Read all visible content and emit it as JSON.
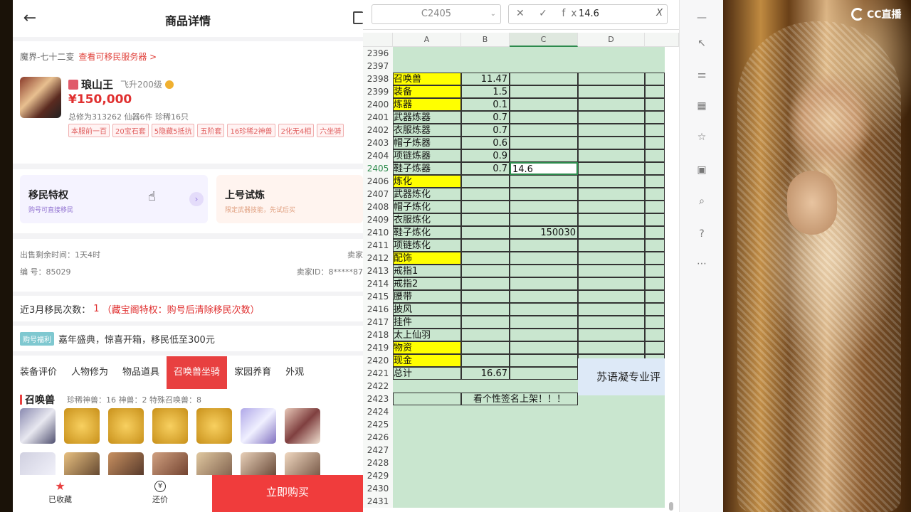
{
  "product_page": {
    "title": "商品详情",
    "server": "魔界-七十二变",
    "server_link": "查看可移民服务器 >",
    "name": "琅山王",
    "level": "飞升200级",
    "price": "¥150,000",
    "stats": "总修为313262 仙器6件 珍稀16只",
    "tags": [
      "本服前一百",
      "20宝石套",
      "5隐藏5抵抗",
      "五阶套",
      "16珍稀2神兽",
      "2化无4相",
      "六坐骑"
    ],
    "privilege_1_title": "移民特权",
    "privilege_1_sub": "购号可直接移民",
    "privilege_2_title": "上号试炼",
    "privilege_2_sub": "限定武器技能，先试后买",
    "remaining": "出售剩余时间：1天4时",
    "serial": "编 号：85029",
    "seller_label": "卖家",
    "seller_id": "卖家ID：8*****87",
    "migrate_label": "近3月移民次数：",
    "migrate_count": "1",
    "migrate_note": "（藏宝阁特权：购号后清除移民次数）",
    "promo_badge": "购号福利",
    "promo_text": "嘉年盛典，惊喜开箱，移民低至300元",
    "tabs": [
      "装备评价",
      "人物修为",
      "物品道具",
      "召唤兽坐骑",
      "家园养育",
      "外观"
    ],
    "pets_title": "召唤兽",
    "pets_counts": "珍稀神兽：16   神兽：2   特殊召唤兽：8",
    "favorite": "已收藏",
    "bargain": "还价",
    "buy": "立即购买"
  },
  "sheet": {
    "namebox": "C2405",
    "formula_controls": "✕ ✓ fx",
    "formula_value": "14.6",
    "columns": [
      "A",
      "B",
      "C",
      "D"
    ],
    "blue_cell": "苏语凝专业评",
    "rows": [
      {
        "n": "2396",
        "a": "",
        "b": "",
        "c": ""
      },
      {
        "n": "2397",
        "a": "",
        "b": "",
        "c": ""
      },
      {
        "n": "2398",
        "a": "召唤兽",
        "b": "11.47",
        "c": "",
        "y": true
      },
      {
        "n": "2399",
        "a": "装备",
        "b": "1.5",
        "c": "",
        "y": true
      },
      {
        "n": "2400",
        "a": "炼器",
        "b": "0.1",
        "c": "",
        "y": true
      },
      {
        "n": "2401",
        "a": "武器炼器",
        "b": "0.7",
        "c": ""
      },
      {
        "n": "2402",
        "a": "衣服炼器",
        "b": "0.7",
        "c": ""
      },
      {
        "n": "2403",
        "a": "帽子炼器",
        "b": "0.6",
        "c": ""
      },
      {
        "n": "2404",
        "a": "项链炼器",
        "b": "0.9",
        "c": ""
      },
      {
        "n": "2405",
        "a": "鞋子炼器",
        "b": "0.7",
        "c": "14.6",
        "active": true
      },
      {
        "n": "2406",
        "a": "炼化",
        "b": "",
        "c": "",
        "y": true
      },
      {
        "n": "2407",
        "a": "武器炼化",
        "b": "",
        "c": ""
      },
      {
        "n": "2408",
        "a": "帽子炼化",
        "b": "",
        "c": ""
      },
      {
        "n": "2409",
        "a": "衣服炼化",
        "b": "",
        "c": ""
      },
      {
        "n": "2410",
        "a": "鞋子炼化",
        "b": "",
        "c": "150030",
        "cnum": true
      },
      {
        "n": "2411",
        "a": "项链炼化",
        "b": "",
        "c": ""
      },
      {
        "n": "2412",
        "a": "配饰",
        "b": "",
        "c": "",
        "y": true
      },
      {
        "n": "2413",
        "a": "戒指1",
        "b": "",
        "c": ""
      },
      {
        "n": "2414",
        "a": "戒指2",
        "b": "",
        "c": ""
      },
      {
        "n": "2415",
        "a": "腰带",
        "b": "",
        "c": ""
      },
      {
        "n": "2416",
        "a": "披风",
        "b": "",
        "c": ""
      },
      {
        "n": "2417",
        "a": "挂件",
        "b": "",
        "c": ""
      },
      {
        "n": "2418",
        "a": "太上仙羽",
        "b": "",
        "c": ""
      },
      {
        "n": "2419",
        "a": "物资",
        "b": "",
        "c": "",
        "y": true
      },
      {
        "n": "2420",
        "a": "现金",
        "b": "",
        "c": "",
        "y": true
      },
      {
        "n": "2421",
        "a": "总计",
        "b": "16.67",
        "c": ""
      },
      {
        "n": "2422",
        "a": "",
        "b": "",
        "c": ""
      },
      {
        "n": "2423",
        "a": "",
        "b": "看个性签名上架！！！",
        "c": "",
        "merged": true
      },
      {
        "n": "2424",
        "a": "",
        "b": "",
        "c": ""
      },
      {
        "n": "2425",
        "a": "",
        "b": "",
        "c": ""
      },
      {
        "n": "2426",
        "a": "",
        "b": "",
        "c": ""
      },
      {
        "n": "2427",
        "a": "",
        "b": "",
        "c": ""
      },
      {
        "n": "2428",
        "a": "",
        "b": "",
        "c": ""
      },
      {
        "n": "2429",
        "a": "",
        "b": "",
        "c": ""
      },
      {
        "n": "2430",
        "a": "",
        "b": "",
        "c": ""
      },
      {
        "n": "2431",
        "a": "",
        "b": "",
        "c": ""
      }
    ]
  },
  "watermark": "CC直播",
  "colors": {
    "accent": "#e84040",
    "yellow": "#ffff00",
    "sheet_green": "#c9e6cf"
  }
}
